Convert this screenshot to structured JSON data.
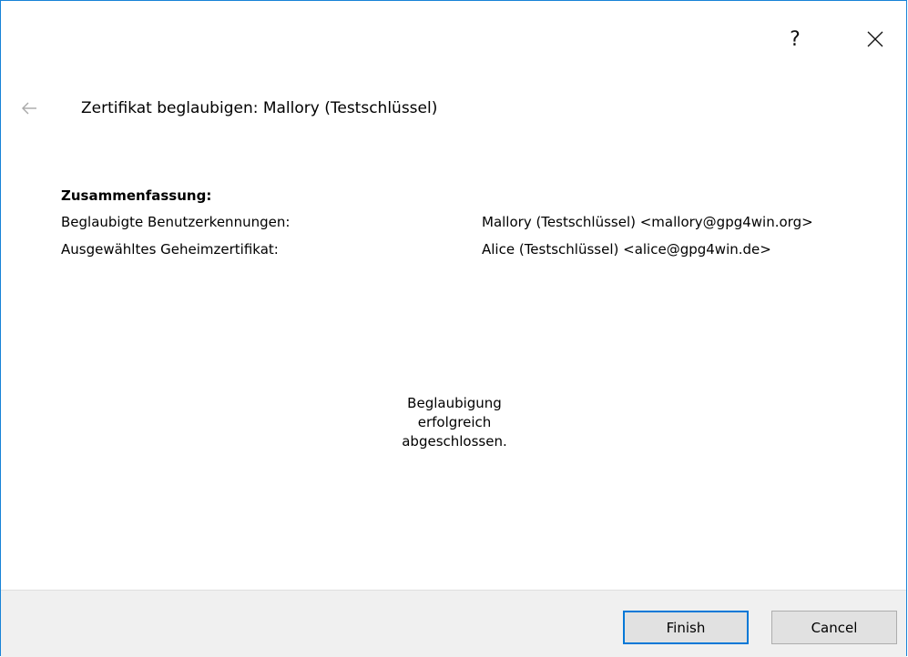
{
  "titlebar": {
    "help_label": "?",
    "close_icon": "close-icon"
  },
  "header": {
    "back_icon": "back-arrow-icon",
    "title": "Zertifikat beglaubigen: Mallory (Testschlüssel)"
  },
  "summary": {
    "heading": "Zusammenfassung:",
    "rows": [
      {
        "label": "Beglaubigte Benutzerkennungen:",
        "value": "Mallory (Testschlüssel) <mallory@gpg4win.org>"
      },
      {
        "label": "Ausgewähltes Geheimzertifikat:",
        "value": "Alice (Testschlüssel) <alice@gpg4win.de>"
      }
    ]
  },
  "status": {
    "lines": [
      "Beglaubigung",
      "erfolgreich",
      "abgeschlossen."
    ]
  },
  "footer": {
    "finish_label": "Finish",
    "cancel_label": "Cancel"
  },
  "colors": {
    "window_border": "#1883d7",
    "footer_bg": "#f0f0f0",
    "default_button_border": "#0078d7"
  }
}
